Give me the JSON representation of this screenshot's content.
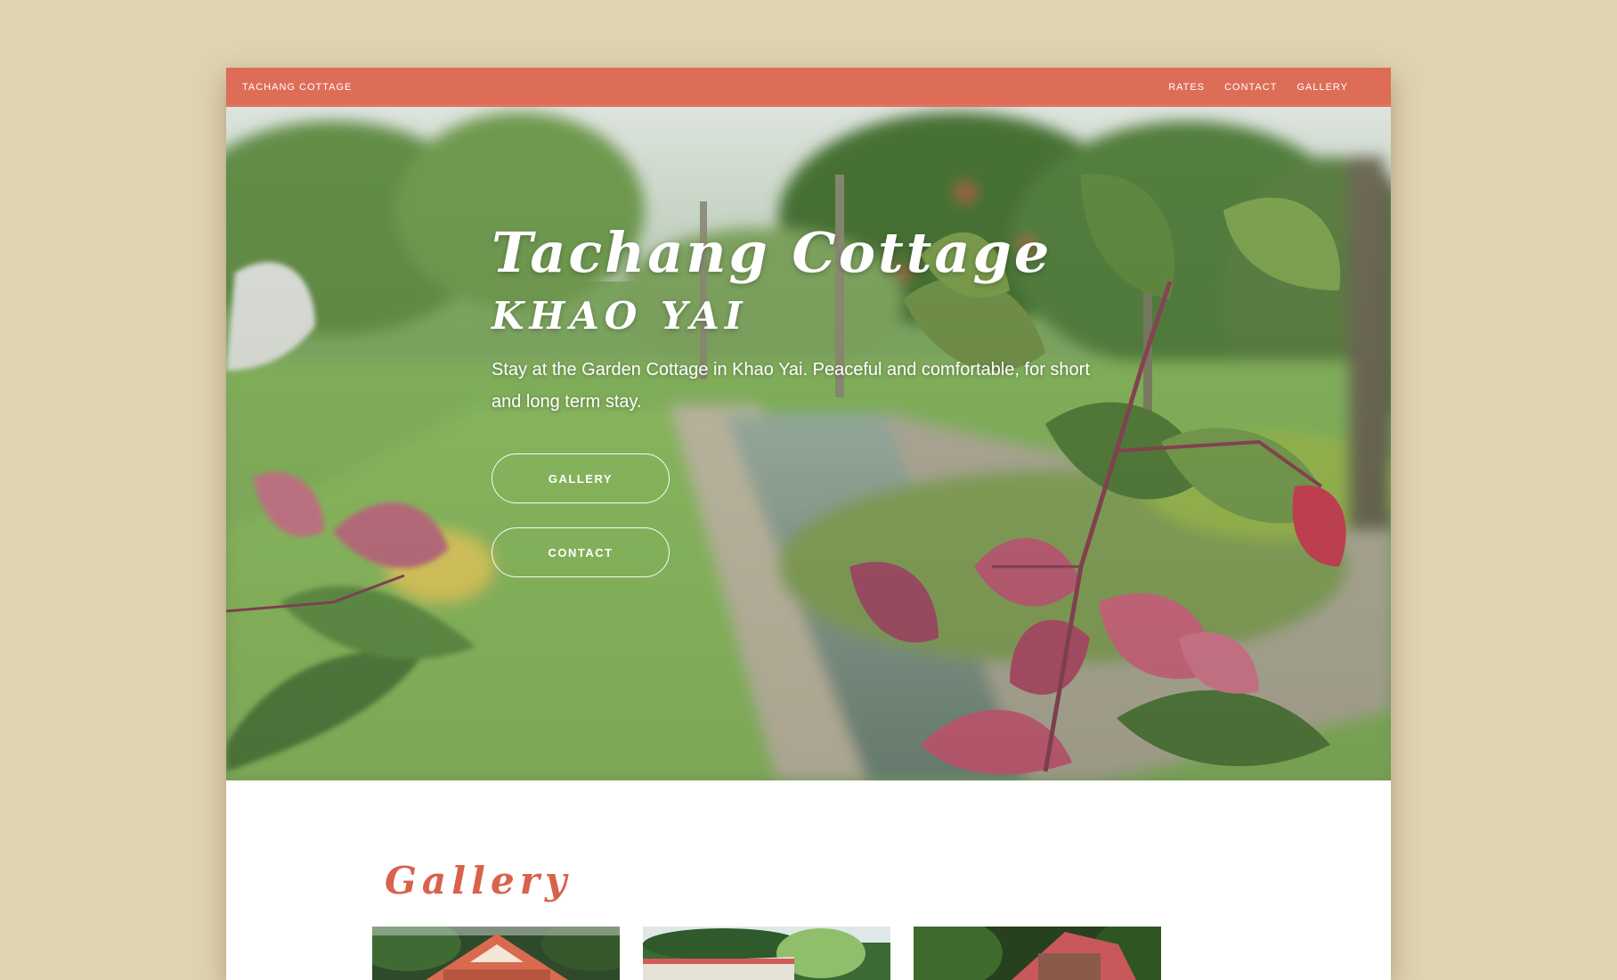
{
  "navbar": {
    "brand": "TACHANG COTTAGE",
    "links": [
      "RATES",
      "CONTACT",
      "GALLERY"
    ]
  },
  "hero": {
    "title": "Tachang Cottage",
    "subtitle": "KHAO YAI",
    "description": "Stay at the Garden Cottage in Khao Yai. Peaceful and comfortable, for short and long term stay.",
    "buttons": {
      "gallery": "GALLERY",
      "contact": "CONTACT"
    }
  },
  "gallery": {
    "heading": "Gallery"
  },
  "colors": {
    "page_background": "#e0d3b2",
    "navbar": "#e46856",
    "accent": "#d9624c"
  }
}
